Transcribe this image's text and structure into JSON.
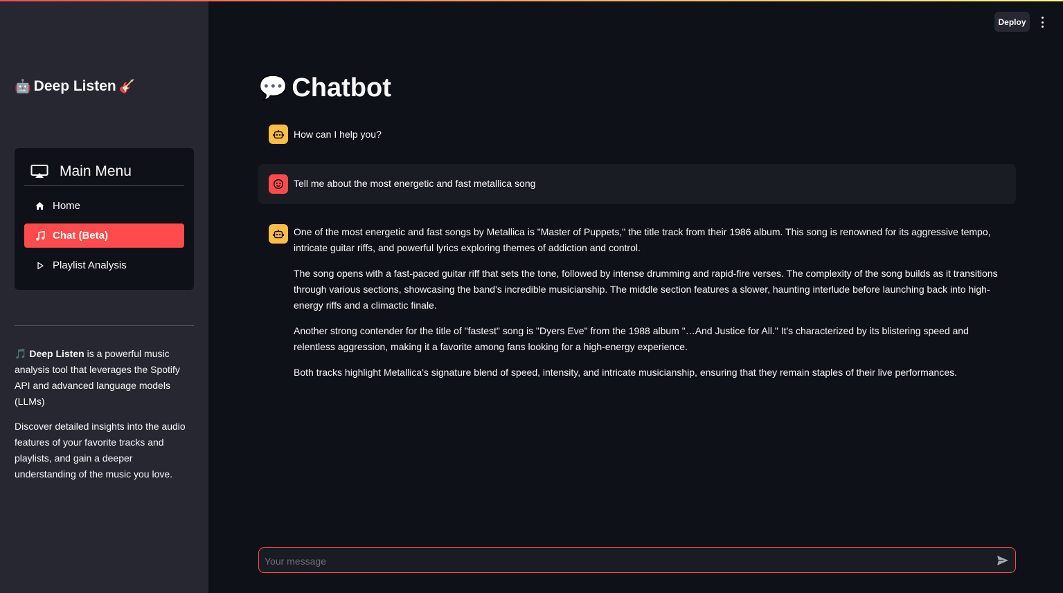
{
  "app": {
    "title": "Deep Listen",
    "title_left_emoji": "🤖",
    "title_right_emoji": "🎸",
    "accent_color": "#ff4b4b"
  },
  "header": {
    "deploy_label": "Deploy",
    "menu_icon": "kebab-menu-icon"
  },
  "sidebar": {
    "menu_title": "Main Menu",
    "menu_icon": "cast-icon",
    "items": [
      {
        "label": "Home",
        "icon": "house-icon",
        "active": false
      },
      {
        "label": "Chat (Beta)",
        "icon": "music-note-icon",
        "active": true
      },
      {
        "label": "Playlist Analysis",
        "icon": "play-icon",
        "active": false
      }
    ],
    "about": {
      "emoji": "🎵",
      "brand": "Deep Listen",
      "p1_rest": " is a powerful music analysis tool that leverages the Spotify API and advanced language models (LLMs)",
      "p2": "Discover detailed insights into the audio features of your favorite tracks and playlists, and gain a deeper understanding of the music you love."
    }
  },
  "main": {
    "title_emoji": "💬",
    "title": "Chatbot",
    "messages": [
      {
        "role": "assistant",
        "avatar": "robot-icon",
        "paragraphs": [
          "How can I help you?"
        ]
      },
      {
        "role": "user",
        "avatar": "smiley-face-icon",
        "paragraphs": [
          "Tell me about the most energetic and fast metallica song"
        ]
      },
      {
        "role": "assistant",
        "avatar": "robot-icon",
        "paragraphs": [
          "One of the most energetic and fast songs by Metallica is \"Master of Puppets,\" the title track from their 1986 album. This song is renowned for its aggressive tempo, intricate guitar riffs, and powerful lyrics exploring themes of addiction and control.",
          "The song opens with a fast-paced guitar riff that sets the tone, followed by intense drumming and rapid-fire verses. The complexity of the song builds as it transitions through various sections, showcasing the band's incredible musicianship. The middle section features a slower, haunting interlude before launching back into high-energy riffs and a climactic finale.",
          "Another strong contender for the title of \"fastest\" song is \"Dyers Eve\" from the 1988 album \"…And Justice for All.\" It's characterized by its blistering speed and relentless aggression, making it a favorite among fans looking for a high-energy experience.",
          "Both tracks highlight Metallica's signature blend of speed, intensity, and intricate musicianship, ensuring that they remain staples of their live performances."
        ]
      }
    ],
    "input": {
      "placeholder": "Your message",
      "value": "",
      "send_icon": "send-icon"
    }
  }
}
